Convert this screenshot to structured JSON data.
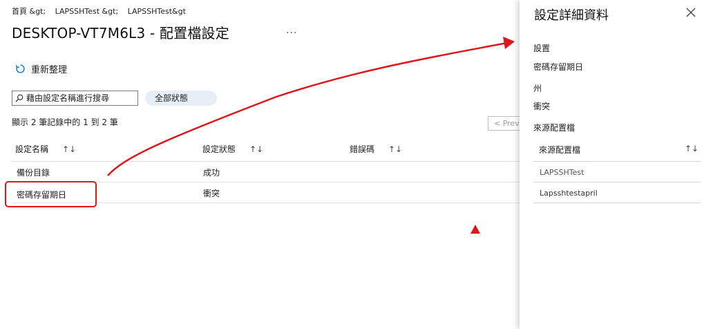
{
  "breadcrumb": {
    "home": "首頁 &gt;",
    "item1": "LAPSSHTest &gt;",
    "item2": "LAPSSHTest&gt"
  },
  "header": {
    "title": "DESKTOP-VT7M6L3 - 配置檔設定",
    "more": "..."
  },
  "toolbar": {
    "refresh_label": "重新整理"
  },
  "search": {
    "placeholder": "藉由設定名稱進行搜尋"
  },
  "filter": {
    "label": "全部狀態"
  },
  "records": {
    "summary": "顯示 2 筆記錄中的 1 到 2 筆",
    "prev_label": "< Previous"
  },
  "table": {
    "columns": [
      {
        "label": "設定名稱"
      },
      {
        "label": "設定狀態"
      },
      {
        "label": "錯誤碼"
      }
    ],
    "rows": [
      {
        "name": "備份目錄",
        "status": "成功"
      },
      {
        "name": "密碼存留期日",
        "status": "衝突"
      }
    ]
  },
  "panel": {
    "title": "設定詳細資料",
    "setting_label": "設置",
    "setting_value": "密碼存留期日",
    "state_label": "州",
    "state_value": "衝突",
    "source_label": "來源配置檔",
    "source_table_header": "來源配置檔",
    "sources": [
      "LAPSSHTest",
      "Lapsshtestapril"
    ]
  },
  "colors": {
    "accent": "#0078d4",
    "annotation": "#e0161b",
    "pill": "#e6eef6"
  }
}
